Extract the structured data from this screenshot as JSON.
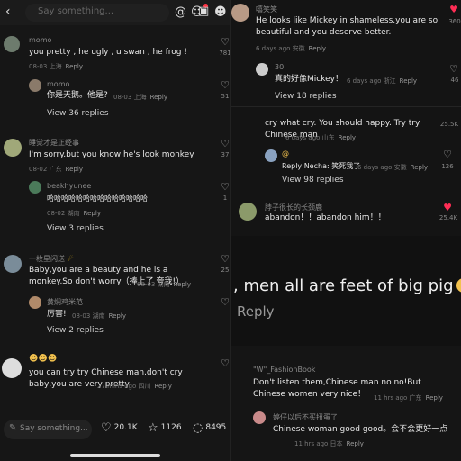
{
  "top_bar": {
    "back_icon": "chevron-left-icon",
    "placeholder": "Say something...",
    "icons": [
      "at-icon",
      "smile-icon",
      "image-icon",
      "emoji-icon"
    ]
  },
  "left_comments": [
    {
      "name": "momo",
      "text": "you pretty , he ugly , u swan , he frog !",
      "date": "08-03 上海",
      "reply": "Reply",
      "likes": "781"
    },
    {
      "name": "momo",
      "text": "你是天鹅。他是?",
      "date": "08-03 上海",
      "reply": "Reply",
      "likes": "51",
      "view": "View 36 replies"
    },
    {
      "name": "睡觉才是正经事",
      "text": "I'm sorry.but you know   he's look monkey",
      "date": "08-02 广东",
      "reply": "Reply",
      "likes": "37"
    },
    {
      "name": "beakhyunee",
      "text": "哈哈哈哈哈哈哈哈哈哈哈哈哈哈",
      "date": "08-02 湖南",
      "reply": "Reply",
      "likes": "1",
      "view": "View 3 replies"
    },
    {
      "name": "一枚星闪送",
      "text": "Baby,you are a beauty and he is a monkey.So don't worry（捧上了 夸我!）",
      "date": "08-03 湖南",
      "reply": "Reply",
      "likes": "25"
    },
    {
      "name": "黄焖鸡米范",
      "text": "厉害!",
      "date": "08-03 湖南",
      "reply": "Reply",
      "likes": "",
      "view": "View 2 replies"
    },
    {
      "name": "",
      "text": "you can try try Chinese man,don't cry baby,you are  very pretty",
      "date": "27 mins ago 四川",
      "reply": "Reply",
      "likes": ""
    }
  ],
  "bottom_bar": {
    "placeholder": "Say something...",
    "likes": "20.1K",
    "favorites": "1126",
    "comments": "8495"
  },
  "right_top_comments": [
    {
      "name": "嘻笑笑",
      "text": "He looks like Mickey in shameless.you are so beautiful and you deserve better.",
      "date": "6 days ago 安徽",
      "reply": "Reply",
      "likes": "360"
    },
    {
      "name": "30",
      "text": "真的好像Mickey！",
      "date": "6 days ago 浙江",
      "reply": "Reply",
      "likes": "46",
      "view": "View 18 replies"
    },
    {
      "name": "",
      "text": "cry what cry. You should happy. Try try Chinese man",
      "date": "6 days ago 山东",
      "reply": "Reply",
      "likes": "25.5K"
    },
    {
      "name": "@",
      "text": "Reply  Necha: 笑死我了",
      "date": "6 days ago 安徽",
      "reply": "Reply",
      "likes": "126",
      "view": "View 98 replies"
    },
    {
      "name": "脖子很长的长颈鹿",
      "text": "abandon！！abandon him！！",
      "date": "",
      "reply": "",
      "likes": "25.4K"
    }
  ],
  "right_mid": {
    "text": ", men all are feet of big pig",
    "reply": "Reply"
  },
  "right_bottom_comments": [
    {
      "name": "\"W\"_FashionBook",
      "text": "Don't listen them,Chinese man no no!But Chinese women very nice！",
      "date": "11 hrs ago 广东",
      "reply": "Reply"
    },
    {
      "name": "婷仔以后不买扭蛋了",
      "text": "Chinese woman good good。会不会更好一点",
      "date": "11 hrs ago 日本",
      "reply": "Reply"
    }
  ],
  "colors": {
    "accent_red": "#ff2d55",
    "background": "#161616"
  }
}
